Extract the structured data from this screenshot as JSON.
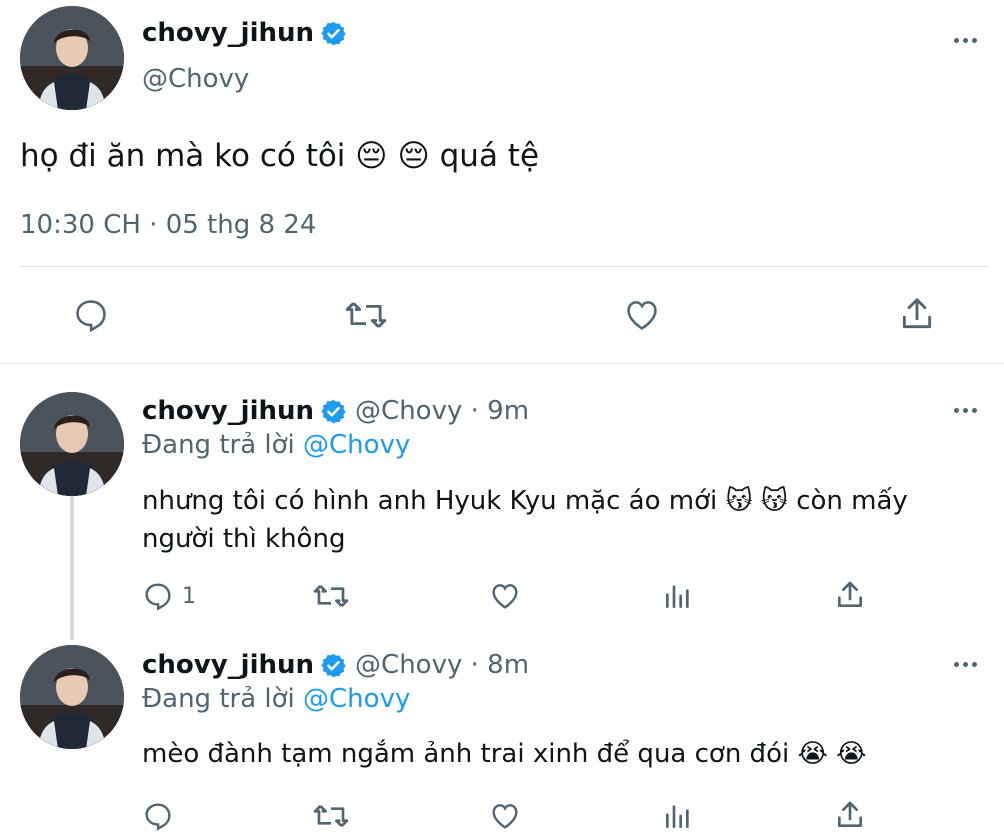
{
  "main_tweet": {
    "display_name": "chovy_jihun",
    "handle": "@Chovy",
    "text": "họ đi ăn mà ko có tôi 😔 😔  quá tệ",
    "timestamp": "10:30 CH · 05 thg 8 24"
  },
  "replies": [
    {
      "display_name": "chovy_jihun",
      "handle_time": "@Chovy · 9m",
      "replying_prefix": "Đang trả lời ",
      "replying_to": "@Chovy",
      "text": "nhưng tôi có hình anh Hyuk Kyu mặc áo mới 😽 😽  còn mấy người thì không",
      "reply_count": "1"
    },
    {
      "display_name": "chovy_jihun",
      "handle_time": "@Chovy · 8m",
      "replying_prefix": "Đang trả lời ",
      "replying_to": "@Chovy",
      "text": "mèo đành tạm ngắm ảnh trai xinh để qua cơn đói 😭 😭",
      "reply_count": ""
    }
  ],
  "icons": {
    "reply": "reply-icon",
    "retweet": "retweet-icon",
    "like": "like-icon",
    "share": "share-icon",
    "views": "views-icon",
    "more": "more-icon",
    "verified": "verified-icon"
  },
  "colors": {
    "link": "#1d9bf0",
    "secondary_text": "#536471",
    "verified": "#1d9bf0",
    "divider": "#dfe3e6"
  }
}
